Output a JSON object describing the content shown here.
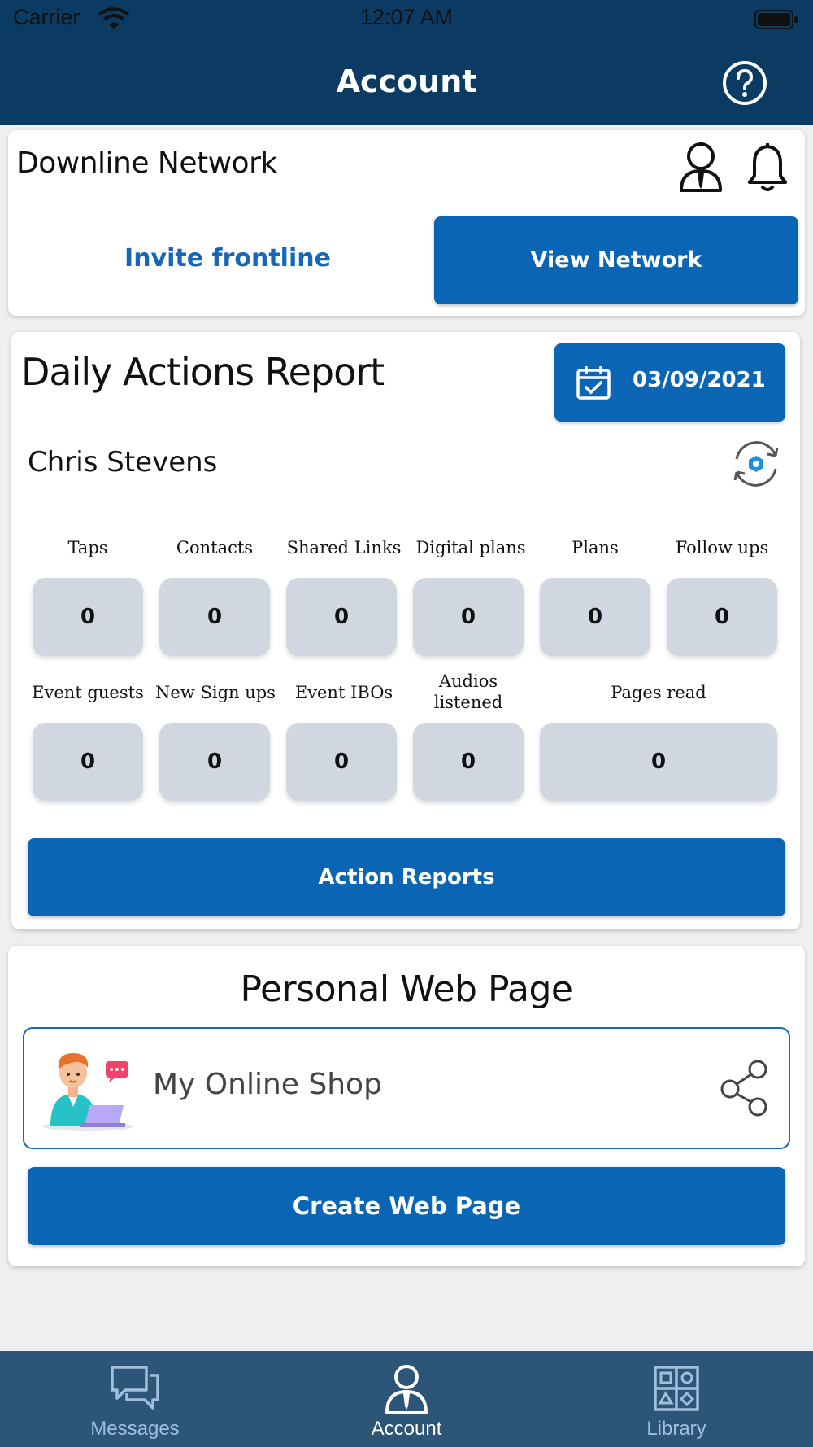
{
  "status_bar": {
    "carrier": "Carrier",
    "time": "12:07 AM"
  },
  "nav": {
    "title": "Account",
    "help_icon": "question-circle-icon"
  },
  "downline": {
    "title": "Downline Network",
    "invite_label": "Invite frontline",
    "view_network_label": "View Network"
  },
  "daily_report": {
    "title": "Daily Actions Report",
    "date": "03/09/2021",
    "person": "Chris Stevens",
    "stats_row1": [
      {
        "label": "Taps",
        "value": "0"
      },
      {
        "label": "Contacts",
        "value": "0"
      },
      {
        "label": "Shared Links",
        "value": "0"
      },
      {
        "label": "Digital plans",
        "value": "0"
      },
      {
        "label": "Plans",
        "value": "0"
      },
      {
        "label": "Follow ups",
        "value": "0"
      }
    ],
    "stats_row2": [
      {
        "label": "Event guests",
        "value": "0"
      },
      {
        "label": "New Sign ups",
        "value": "0"
      },
      {
        "label": "Event IBOs",
        "value": "0"
      },
      {
        "label": "Audios listened",
        "value": "0"
      },
      {
        "label": "Pages read",
        "value": "0"
      }
    ],
    "action_reports_label": "Action Reports"
  },
  "web_page": {
    "title": "Personal Web Page",
    "shop_name": "My Online Shop",
    "create_label": "Create Web Page"
  },
  "tabs": [
    {
      "label": "Messages",
      "icon": "chat-bubbles-icon",
      "active": false
    },
    {
      "label": "Account",
      "icon": "user-icon",
      "active": true
    },
    {
      "label": "Library",
      "icon": "grid-icon",
      "active": false
    }
  ],
  "colors": {
    "navy": "#0b3b63",
    "primary": "#0a65b5",
    "stat_box": "#d0d7e0",
    "tab_bar": "#2d5577"
  }
}
